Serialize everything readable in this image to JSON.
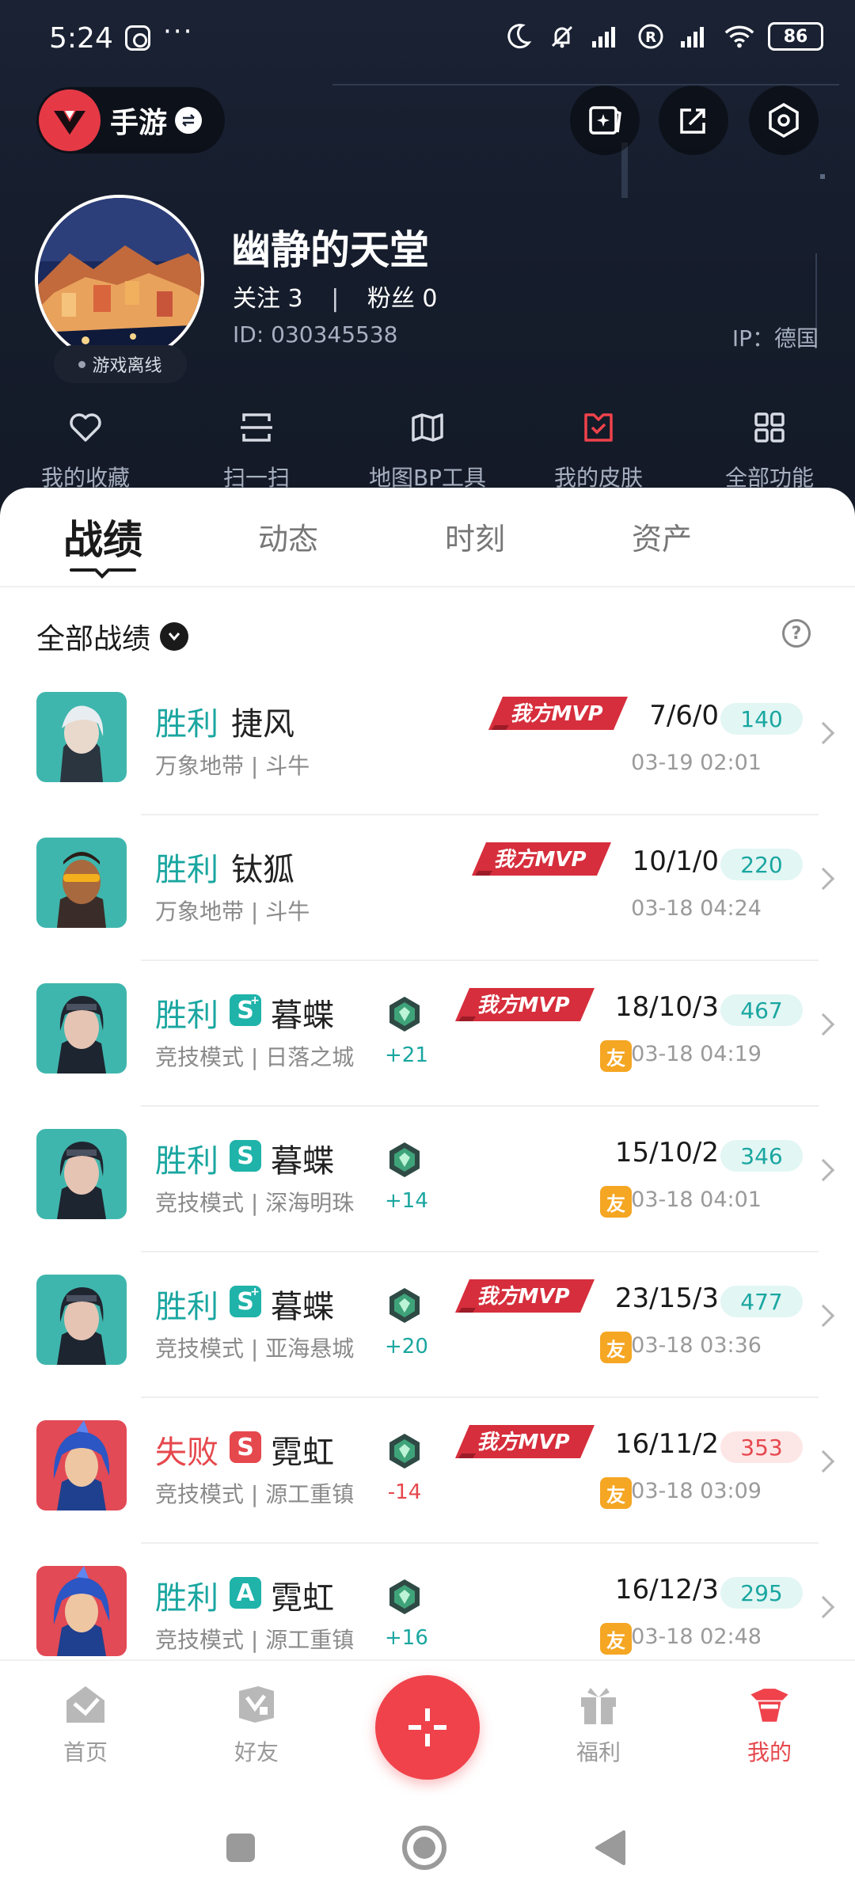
{
  "status_bar": {
    "time": "5:24",
    "more": "···",
    "battery": "86"
  },
  "header": {
    "game_label": "手游",
    "nickname": "幽静的天堂",
    "follow_label": "关注",
    "follow_count": "3",
    "separator": "|",
    "fans_label": "粉丝",
    "fans_count": "0",
    "uid": "ID: 030345538",
    "ip": "IP：德国",
    "avatar_status": "游戏离线",
    "quick_actions": [
      "我的收藏",
      "扫一扫",
      "地图BP工具",
      "我的皮肤",
      "全部功能"
    ]
  },
  "tabs": [
    "战绩",
    "动态",
    "时刻",
    "资产"
  ],
  "filter_label": "全部战绩",
  "help_label": "?",
  "colors": {
    "accent_red": "#e5484d",
    "win_teal": "#1aa6a0",
    "friend_orange": "#f5a623"
  },
  "records": [
    {
      "result": "胜利",
      "outcome": "win",
      "grade": "",
      "hero": "捷风",
      "mode": "万象地带 | 斗牛",
      "rank_delta": "",
      "mvp": true,
      "mvp_text": "我方MVP",
      "kda": "7/6/0",
      "score": "140",
      "friend": false,
      "friend_label": "",
      "time": "03-19 02:01",
      "thumb": "silver"
    },
    {
      "result": "胜利",
      "outcome": "win",
      "grade": "",
      "hero": "钛狐",
      "mode": "万象地带 | 斗牛",
      "rank_delta": "",
      "mvp": true,
      "mvp_text": "我方MVP",
      "kda": "10/1/0",
      "score": "220",
      "friend": false,
      "friend_label": "",
      "time": "03-18 04:24",
      "thumb": "brown"
    },
    {
      "result": "胜利",
      "outcome": "win",
      "grade": "S+",
      "hero": "暮蝶",
      "mode": "竞技模式 | 日落之城",
      "rank_delta": "+21",
      "mvp": true,
      "mvp_text": "我方MVP",
      "kda": "18/10/3",
      "score": "467",
      "friend": true,
      "friend_label": "友",
      "time": "03-18 04:19",
      "thumb": "teal"
    },
    {
      "result": "胜利",
      "outcome": "win",
      "grade": "S",
      "hero": "暮蝶",
      "mode": "竞技模式 | 深海明珠",
      "rank_delta": "+14",
      "mvp": false,
      "mvp_text": "",
      "kda": "15/10/2",
      "score": "346",
      "friend": true,
      "friend_label": "友",
      "time": "03-18 04:01",
      "thumb": "teal"
    },
    {
      "result": "胜利",
      "outcome": "win",
      "grade": "S+",
      "hero": "暮蝶",
      "mode": "竞技模式 | 亚海悬城",
      "rank_delta": "+20",
      "mvp": true,
      "mvp_text": "我方MVP",
      "kda": "23/15/3",
      "score": "477",
      "friend": true,
      "friend_label": "友",
      "time": "03-18 03:36",
      "thumb": "teal"
    },
    {
      "result": "失败",
      "outcome": "lose",
      "grade": "S",
      "hero": "霓虹",
      "mode": "竞技模式 | 源工重镇",
      "rank_delta": "-14",
      "mvp": true,
      "mvp_text": "我方MVP",
      "kda": "16/11/2",
      "score": "353",
      "friend": true,
      "friend_label": "友",
      "time": "03-18 03:09",
      "thumb": "blue"
    },
    {
      "result": "胜利",
      "outcome": "win",
      "grade": "A",
      "hero": "霓虹",
      "mode": "竞技模式 | 源工重镇",
      "rank_delta": "+16",
      "mvp": false,
      "mvp_text": "",
      "kda": "16/12/3",
      "score": "295",
      "friend": true,
      "friend_label": "友",
      "time": "03-18 02:48",
      "thumb": "blue"
    }
  ],
  "bottom_nav": {
    "items": [
      "首页",
      "好友",
      "福利",
      "我的"
    ],
    "active": "我的"
  }
}
